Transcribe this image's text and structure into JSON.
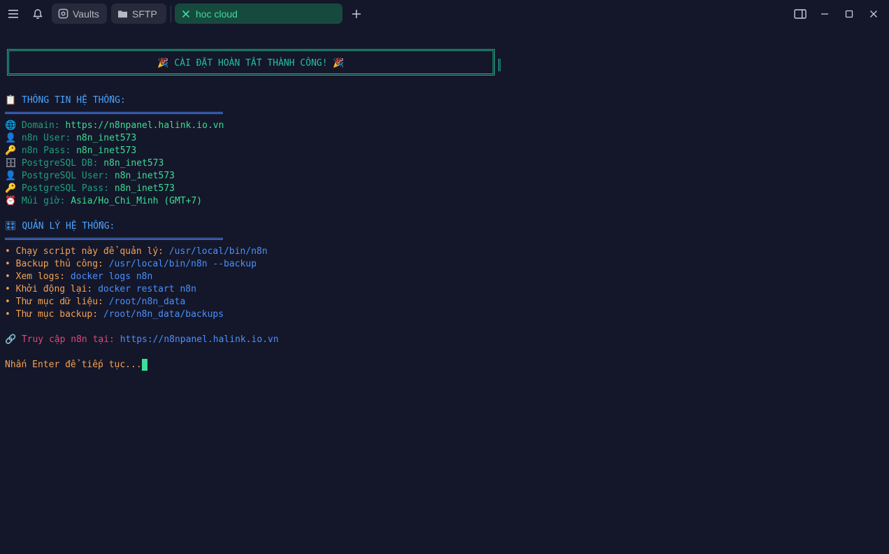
{
  "titlebar": {
    "tabs": [
      {
        "label": "Vaults"
      },
      {
        "label": "SFTP"
      },
      {
        "label": "hoc cloud"
      }
    ]
  },
  "banner": {
    "text": "🎉 CÀI ĐẶT HOÀN TẤT THÀNH CÔNG! 🎉"
  },
  "system_info": {
    "heading": "📋 THÔNG TIN HỆ THỐNG:",
    "rows": [
      {
        "icon": "🌐",
        "label": "Domain:",
        "value": "https://n8npanel.halink.io.vn"
      },
      {
        "icon": "👤",
        "label": "n8n User:",
        "value": "n8n_inet573"
      },
      {
        "icon": "🔑",
        "label": "n8n Pass:",
        "value": "n8n_inet573"
      },
      {
        "icon": "🗄",
        "label": "PostgreSQL DB:",
        "value": "n8n_inet573"
      },
      {
        "icon": "👤",
        "label": "PostgreSQL User:",
        "value": "n8n_inet573"
      },
      {
        "icon": "🔑",
        "label": "PostgreSQL Pass:",
        "value": "n8n_inet573"
      },
      {
        "icon": "⏰",
        "label": "Múi giờ:",
        "value": "Asia/Ho_Chi_Minh (GMT+7)"
      }
    ]
  },
  "management": {
    "heading": "🎛 QUẢN LÝ HỆ THỐNG:",
    "rows": [
      {
        "label": "• Chạy script này để quản lý:",
        "value": "/usr/local/bin/n8n"
      },
      {
        "label": "• Backup thủ công:",
        "value": "/usr/local/bin/n8n --backup"
      },
      {
        "label": "• Xem logs:",
        "value": "docker logs n8n"
      },
      {
        "label": "• Khởi động lại:",
        "value": "docker restart n8n"
      },
      {
        "label": "• Thư mục dữ liệu:",
        "value": "/root/n8n_data"
      },
      {
        "label": "• Thư mục backup:",
        "value": "/root/n8n_data/backups"
      }
    ]
  },
  "access": {
    "icon": "🔗",
    "label": "Truy cập n8n tại:",
    "value": "https://n8npanel.halink.io.vn"
  },
  "prompt": {
    "text": "Nhấn Enter để tiếp tục..."
  },
  "colors": {
    "background": "#141729",
    "accent_green": "#3ddc97",
    "heading_blue": "#4aa3ff",
    "bullet_orange": "#f5a155",
    "link_pink": "#e1457c"
  }
}
